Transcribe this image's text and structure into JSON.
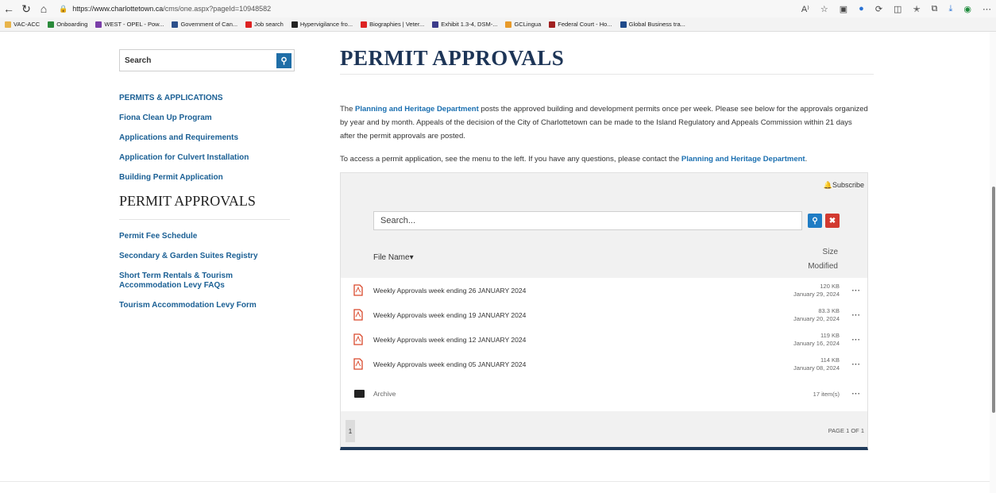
{
  "browser": {
    "url_host": "https://www.charlottetown.ca",
    "url_path": "/cms/one.aspx?pageId=10948582",
    "read_aloud": "A⁾",
    "bookmarks": [
      {
        "label": "VAC-ACC",
        "color": "#e8b44a"
      },
      {
        "label": "Onboarding",
        "color": "#2a8a3a"
      },
      {
        "label": "WEST - OPEL - Pow...",
        "color": "#7a3ea8"
      },
      {
        "label": "Government of Can...",
        "color": "#2b4f8a"
      },
      {
        "label": "Job search",
        "color": "#d22"
      },
      {
        "label": "Hypervigilance fro...",
        "color": "#222"
      },
      {
        "label": "Biographies | Veter...",
        "color": "#d22"
      },
      {
        "label": "Exhibit 1.3-4, DSM-...",
        "color": "#3b3b8a"
      },
      {
        "label": "GCLingua",
        "color": "#e89a2a"
      },
      {
        "label": "Federal Court - Ho...",
        "color": "#a02020"
      },
      {
        "label": "Global Business tra...",
        "color": "#1f4a8a"
      }
    ]
  },
  "sidebar": {
    "search_label": "Search",
    "links_top": [
      "PERMITS & APPLICATIONS",
      "Fiona Clean Up Program",
      "Applications and Requirements",
      "Application for Culvert Installation",
      "Building Permit Application"
    ],
    "heading": "PERMIT APPROVALS",
    "links_bottom": [
      "Permit Fee Schedule",
      "Secondary & Garden Suites Registry",
      "Short Term Rentals & Tourism Accommodation Levy FAQs",
      "Tourism Accommodation Levy Form"
    ]
  },
  "main": {
    "title": "PERMIT APPROVALS",
    "intro_pre": "The ",
    "intro_link": "Planning and Heritage Department",
    "intro_post": " posts the approved building and development permits once per week. Please see below for the approvals organized by year and by month. Appeals of the decision of the City of Charlottetown can be made to the Island Regulatory and Appeals Commission within 21 days after the permit approvals are posted.",
    "access_pre": "To access a permit application, see the menu to the left. If you have any questions, please contact the ",
    "access_link": "Planning and Heritage Department",
    "access_post": "."
  },
  "files": {
    "subscribe": "Subscribe",
    "search_placeholder": "Search...",
    "col_name": "File Name▾",
    "col_size": "Size",
    "col_modified": "Modified",
    "rows": [
      {
        "name": "Weekly Approvals week ending 26 JANUARY 2024",
        "size": "120 KB",
        "date": "January 29, 2024"
      },
      {
        "name": "Weekly Approvals week ending 19 JANUARY 2024",
        "size": "83.3 KB",
        "date": "January 20, 2024"
      },
      {
        "name": "Weekly Approvals week ending 12 JANUARY 2024",
        "size": "119 KB",
        "date": "January 16, 2024"
      },
      {
        "name": "Weekly Approvals week ending 05 JANUARY 2024",
        "size": "114 KB",
        "date": "January 08, 2024"
      }
    ],
    "archive": {
      "name": "Archive",
      "count": "17 item(s)"
    },
    "page_current": "1",
    "page_of": "PAGE 1 OF 1"
  }
}
